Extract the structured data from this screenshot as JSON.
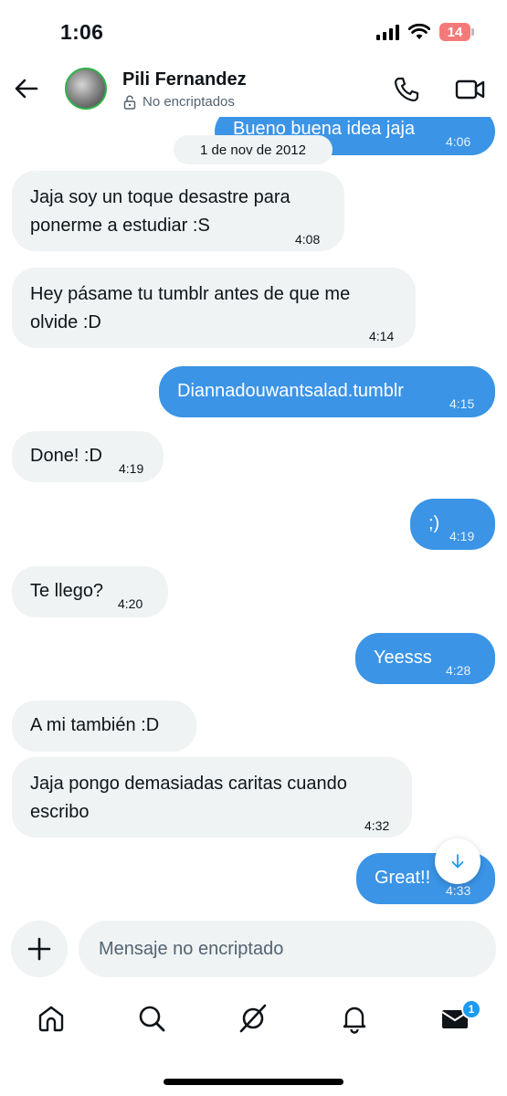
{
  "status_bar": {
    "time": "1:06",
    "battery": "14"
  },
  "header": {
    "contact_name": "Pili Fernandez",
    "encryption_status": "No encriptados"
  },
  "date_separator": "1 de nov de 2012",
  "messages": [
    {
      "direction": "out",
      "text": "Bueno buena idea jaja",
      "time": "4:06"
    },
    {
      "direction": "in",
      "text": "Jaja soy un toque desastre para\nponerme a estudiar :S",
      "time": "4:08"
    },
    {
      "direction": "in",
      "text": "Hey pásame tu tumblr antes de que me\nolvide :D",
      "time": "4:14"
    },
    {
      "direction": "out",
      "text": "Diannadouwantsalad.tumblr",
      "time": "4:15"
    },
    {
      "direction": "in",
      "text": "Done! :D",
      "time": "4:19"
    },
    {
      "direction": "out",
      "text": ";)",
      "time": "4:19"
    },
    {
      "direction": "in",
      "text": "Te llego?",
      "time": "4:20"
    },
    {
      "direction": "out",
      "text": "Yeesss",
      "time": "4:28"
    },
    {
      "direction": "in",
      "text": "A mi también :D",
      "time": ""
    },
    {
      "direction": "in",
      "text": "Jaja pongo demasiadas caritas cuando\nescribo",
      "time": "4:32"
    },
    {
      "direction": "out",
      "text": "Great!!",
      "time": "4:33"
    }
  ],
  "compose": {
    "placeholder": "Mensaje no encriptado"
  },
  "nav": {
    "items": [
      "home-icon",
      "search-icon",
      "grok-icon",
      "notifications-icon",
      "messages-icon"
    ],
    "messages_badge": "1"
  },
  "colors": {
    "outgoing_bubble": "#3b94e6",
    "incoming_bubble": "#eff3f4",
    "avatar_ring": "#2fb34a",
    "accent": "#1d9bf0"
  }
}
